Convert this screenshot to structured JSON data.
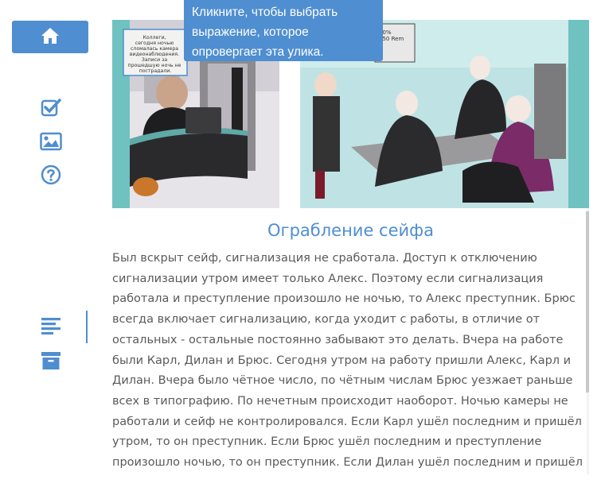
{
  "tooltip": {
    "text": "Кликните, чтобы выбрать выражение, которое опровергает эта улика."
  },
  "note": {
    "text": "Коллеги, сегодня ночью сломалась камера видеонаблюдения. Записи за прошедшую ночь не пострадали."
  },
  "board": {
    "text": "10% 150 Rem"
  },
  "story": {
    "title": "Ограбление сейфа",
    "body": "Был вскрыт сейф, сигнализация не сработала. Доступ к отключению сигнализации утром имеет только Алекс. Поэтому если сигнализация работала и преступление произошло не ночью, то Алекс преступник. Брюс всегда включает сигнализацию, когда уходит с работы, в отличие от остальных - остальные постоянно забывают это делать. Вчера на работе были Карл, Дилан и Брюс. Сегодня утром на работу пришли Алекс, Карл и Дилан. Вчера было чётное число, по чётным числам Брюс уезжает раньше всех в типографию. По нечетным происходит наоборот. Ночью камеры не работали и сейф не контролировался. Если Карл ушёл последним и пришёл утром, то он преступник. Если Брюс ушёл последним и преступление произошло ночью, то он преступник. Если Дилан ушёл последним и пришёл утром, то он"
  },
  "sidebar": {
    "icons": [
      "home-icon",
      "checkbox-icon",
      "image-icon",
      "help-icon",
      "text-lines-icon",
      "archive-icon"
    ]
  },
  "colors": {
    "accent": "#4f8ed0",
    "text": "#5a5a5a",
    "teal": "#6fc2c0"
  }
}
